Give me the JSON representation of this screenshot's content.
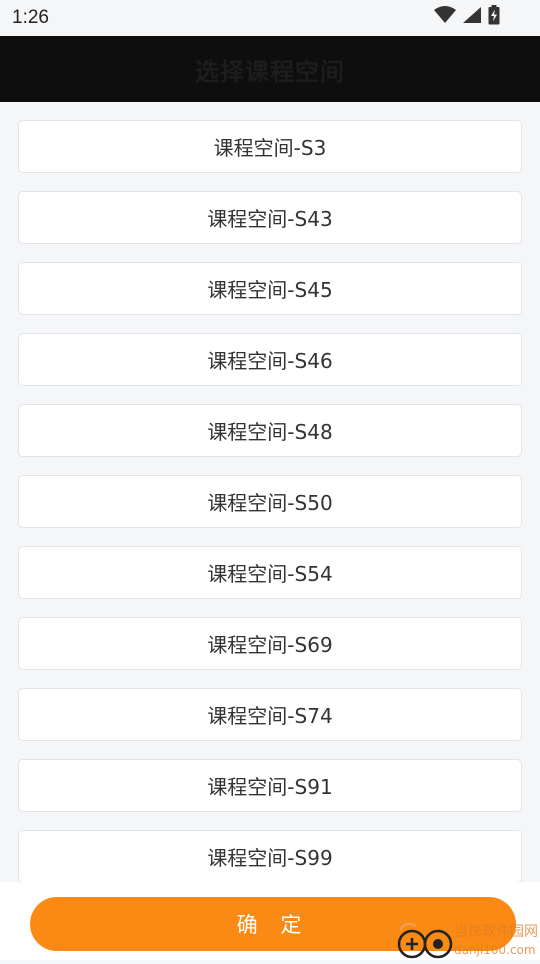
{
  "status_bar": {
    "time": "1:26",
    "icons": [
      "wifi-icon",
      "cellular-signal-icon",
      "battery-charging-icon"
    ]
  },
  "app_bar": {
    "title": "选择课程空间"
  },
  "course_spaces": [
    {
      "label": "课程空间-S3"
    },
    {
      "label": "课程空间-S43"
    },
    {
      "label": "课程空间-S45"
    },
    {
      "label": "课程空间-S46"
    },
    {
      "label": "课程空间-S48"
    },
    {
      "label": "课程空间-S50"
    },
    {
      "label": "课程空间-S54"
    },
    {
      "label": "课程空间-S69"
    },
    {
      "label": "课程空间-S74"
    },
    {
      "label": "课程空间-S91"
    },
    {
      "label": "课程空间-S99"
    }
  ],
  "confirm_button": {
    "label": "确 定"
  },
  "watermark": {
    "text": "当快软件园网",
    "url_text": "danji100.com"
  },
  "colors": {
    "accent": "#fa8a14",
    "app_bar_bg": "#0e0e0e",
    "page_bg": "#f5f6f8",
    "item_border": "#e1e4e9"
  }
}
